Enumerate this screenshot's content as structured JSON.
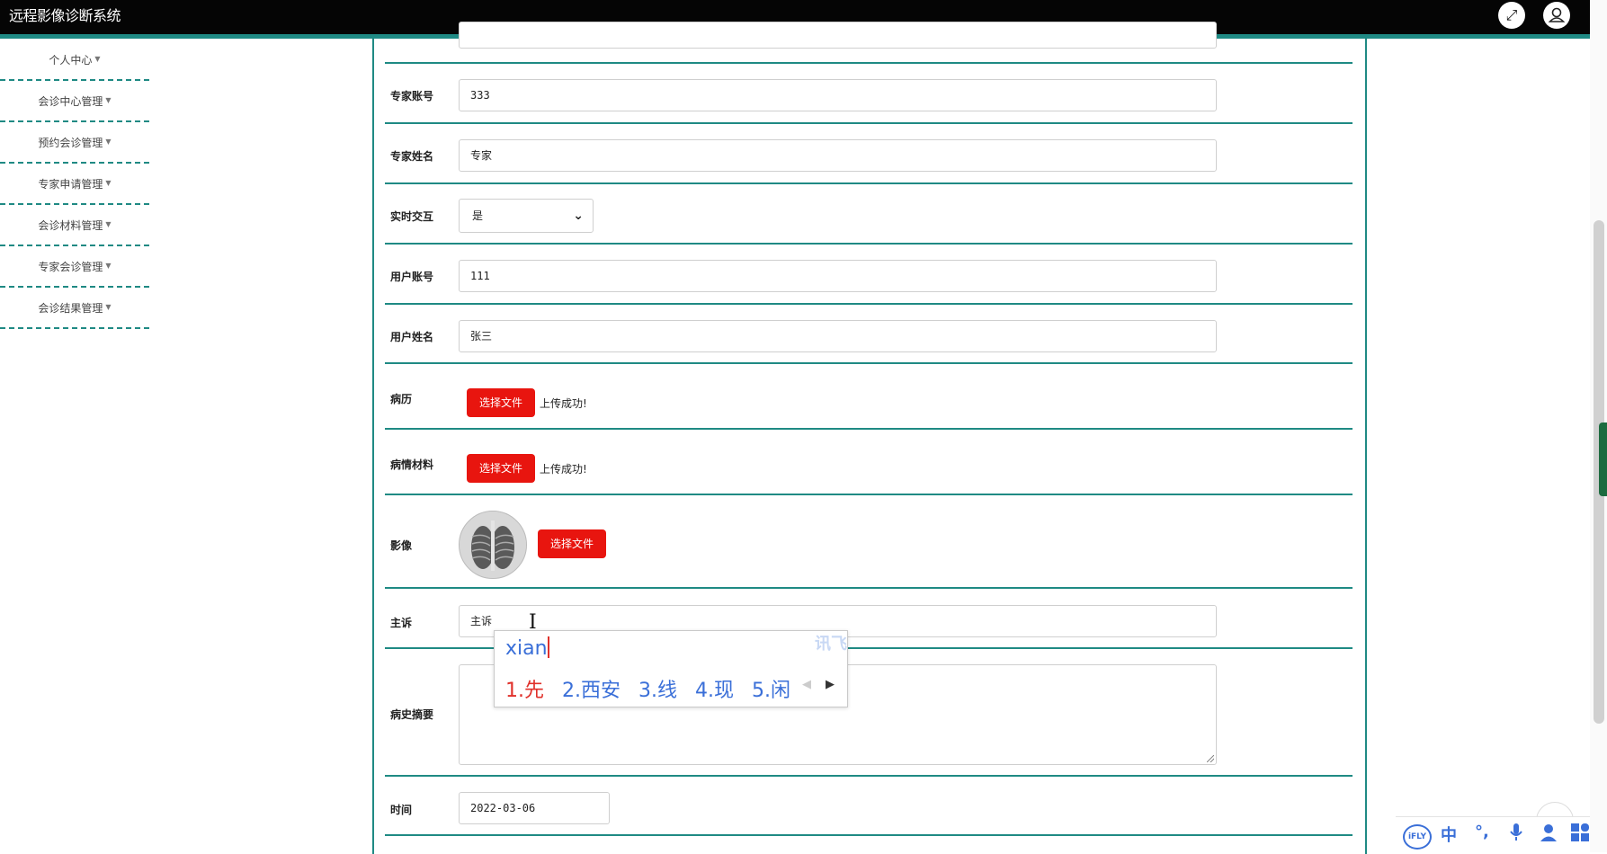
{
  "app": {
    "title": "远程影像诊断系统"
  },
  "header_icons": {
    "expand": "expand-arrows-icon",
    "user": "user-icon"
  },
  "sidebar": {
    "items": [
      {
        "label": "个人中心"
      },
      {
        "label": "会诊中心管理"
      },
      {
        "label": "预约会诊管理"
      },
      {
        "label": "专家申请管理"
      },
      {
        "label": "会诊材料管理"
      },
      {
        "label": "专家会诊管理"
      },
      {
        "label": "会诊结果管理"
      }
    ]
  },
  "form": {
    "expert_account": {
      "label": "专家账号",
      "value": "333"
    },
    "expert_name": {
      "label": "专家姓名",
      "value": "专家"
    },
    "realtime": {
      "label": "实时交互",
      "value": "是"
    },
    "user_account": {
      "label": "用户账号",
      "value": "111"
    },
    "user_name": {
      "label": "用户姓名",
      "value": "张三"
    },
    "medical_record": {
      "label": "病历",
      "button": "选择文件",
      "status": "上传成功!"
    },
    "condition_material": {
      "label": "病情材料",
      "button": "选择文件",
      "status": "上传成功!"
    },
    "image": {
      "label": "影像",
      "button": "选择文件"
    },
    "complaint": {
      "label": "主诉",
      "value": "主诉"
    },
    "history_summary": {
      "label": "病史摘要",
      "value": ""
    },
    "time": {
      "label": "时间",
      "value": "2022-03-06"
    }
  },
  "ime": {
    "composition": "xian",
    "candidates": [
      "1.先",
      "2.西安",
      "3.线",
      "4.现",
      "5.闲"
    ],
    "logo": "讯飞"
  },
  "ime_toolbar": {
    "items": [
      "iFLY",
      "中",
      "°,",
      "mic-icon",
      "user-icon",
      "grid-icon"
    ]
  }
}
